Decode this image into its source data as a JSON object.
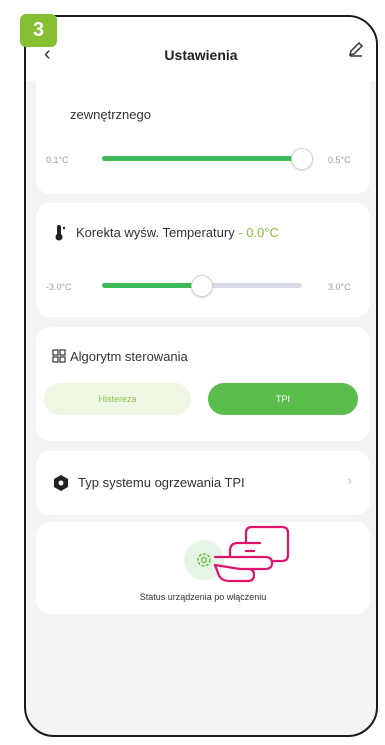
{
  "step_badge": "3",
  "header": {
    "title": "Ustawienia",
    "back_icon": "chevron-left-icon",
    "edit_icon": "pencil-icon"
  },
  "card1": {
    "label": "zewnętrznego",
    "min": "0.1°C",
    "max": "0.5°C",
    "slider_fraction": 1.0
  },
  "card2": {
    "label": "Korekta wyśw. Temperatury",
    "value": "0.0°C",
    "min": "-3.0°C",
    "max": "3.0°C",
    "slider_fraction": 0.5
  },
  "card3": {
    "label": "Algorytm sterowania",
    "options": [
      "Histereza",
      "TPI"
    ],
    "selected": "TPI"
  },
  "card4": {
    "label": "Typ systemu ogrzewania TPI"
  },
  "card5": {
    "label": "Status urządzenia po włączeniu"
  },
  "colors": {
    "accent": "#86bf31",
    "slider": "#3dbb57",
    "toggle_active": "#5bbd4b",
    "hand": "#e0146e"
  }
}
